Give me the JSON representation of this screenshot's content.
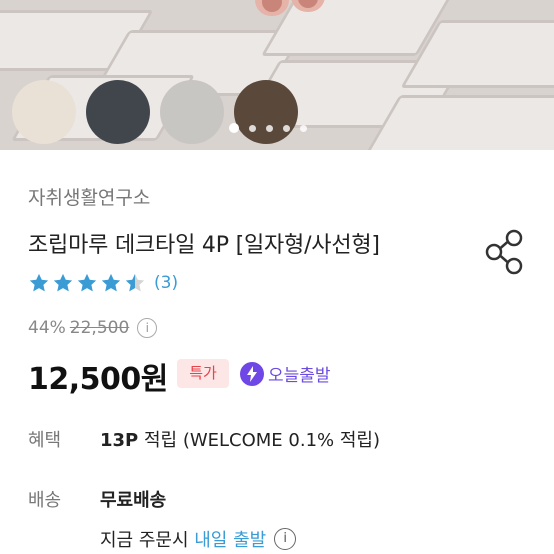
{
  "hero": {
    "swatches": [
      {
        "name": "beige",
        "color": "#e9e1d6"
      },
      {
        "name": "charcoal",
        "color": "#40464c"
      },
      {
        "name": "light-gray",
        "color": "#c8c6c2"
      },
      {
        "name": "brown",
        "color": "#5a483a"
      }
    ],
    "dots": 5,
    "active_dot": 0
  },
  "product": {
    "brand": "자취생활연구소",
    "title": "조립마루 데크타일 4P [일자형/사선형]",
    "rating": 4.5,
    "review_count": "(3)",
    "discount": "44%",
    "original_price": "22,500",
    "price": "12,500원",
    "badge_sale": "특가",
    "badge_today": "오늘출발"
  },
  "details": {
    "benefit_label": "혜택",
    "benefit_points": "13P",
    "benefit_text": " 적립 (WELCOME 0.1% 적립)",
    "shipping_label": "배송",
    "shipping_value": "무료배송",
    "order_prefix": "지금 주문시 ",
    "order_highlight": "내일 출발"
  },
  "colors": {
    "accent_blue": "#3a9bd5",
    "sale_red": "#e8424a",
    "today_purple": "#6b4be0"
  }
}
